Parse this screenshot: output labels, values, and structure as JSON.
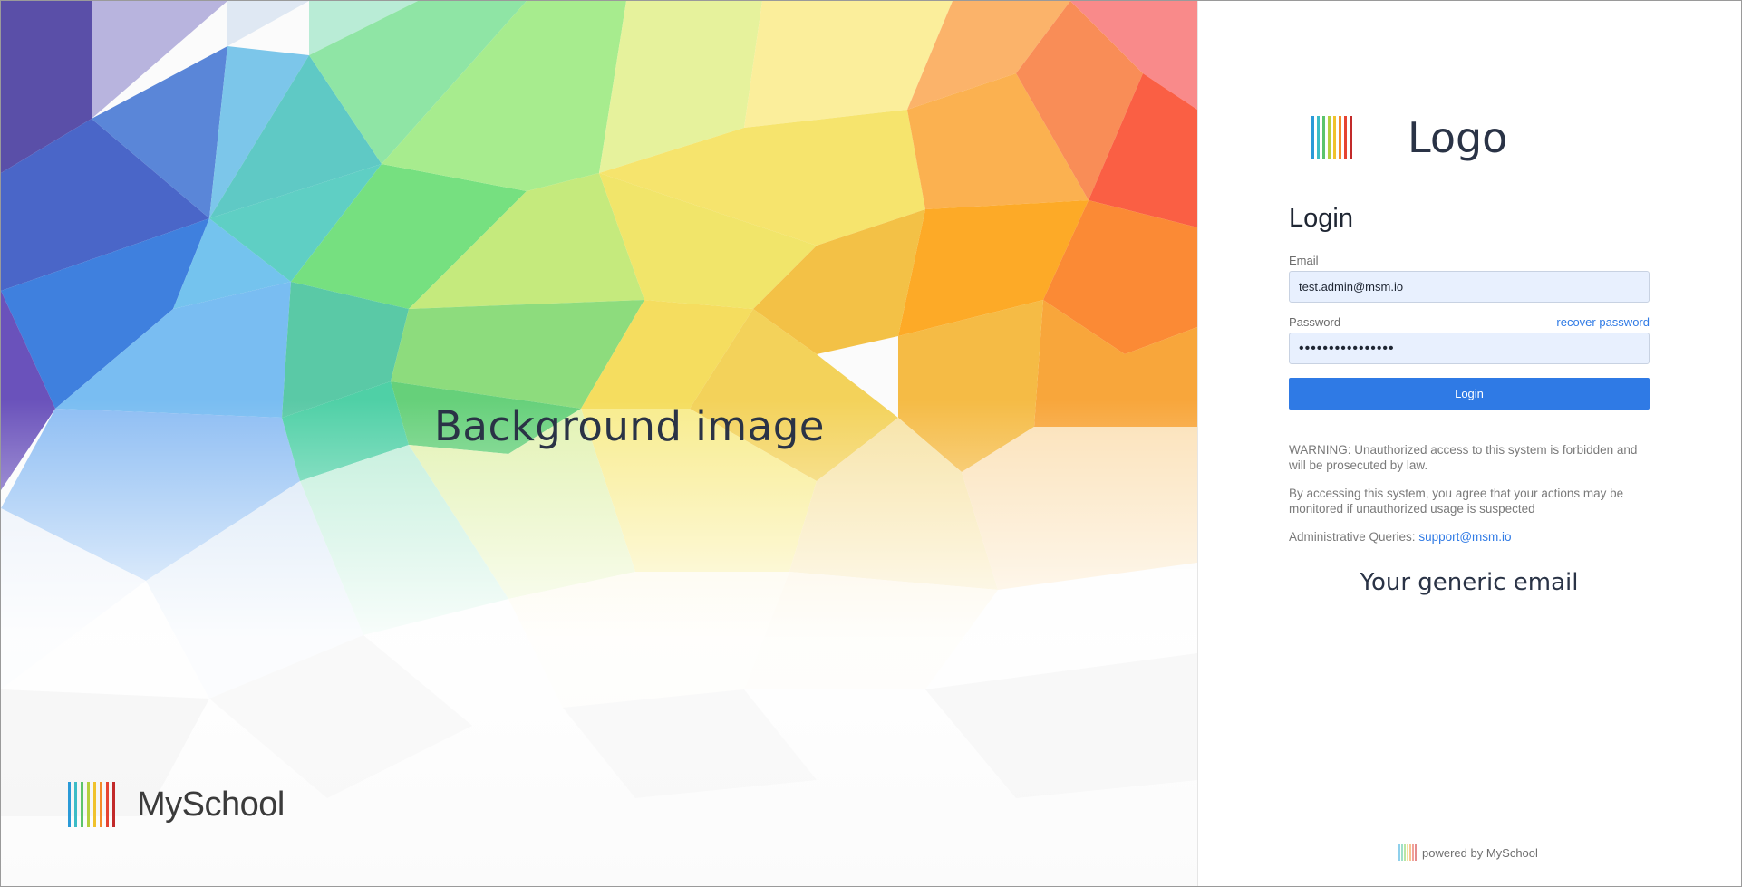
{
  "left": {
    "caption": "Background image",
    "brand_name": "MySchool",
    "brand_icon": "striped-bars-logo-icon"
  },
  "right": {
    "logo_text": "Logo",
    "logo_icon": "striped-bars-logo-icon",
    "form": {
      "title": "Login",
      "email_label": "Email",
      "email_value": "test.admin@msm.io",
      "password_label": "Password",
      "password_value": "••••••••••••••••",
      "recover_link": "recover password",
      "login_button": "Login"
    },
    "notice": {
      "warning": "WARNING: Unauthorized access to this system is forbidden and will be prosecuted by law.",
      "agreement": "By accessing this system, you agree that your actions may be monitored if unauthorized usage is suspected",
      "queries_label": "Administrative Queries:",
      "support_email": "support@msm.io"
    },
    "generic_email": "Your generic email",
    "powered_by": "powered by MySchool"
  },
  "colors": {
    "accent": "#2f7ae5",
    "heading": "#2a3346",
    "input_bg": "#e8f0fe"
  }
}
